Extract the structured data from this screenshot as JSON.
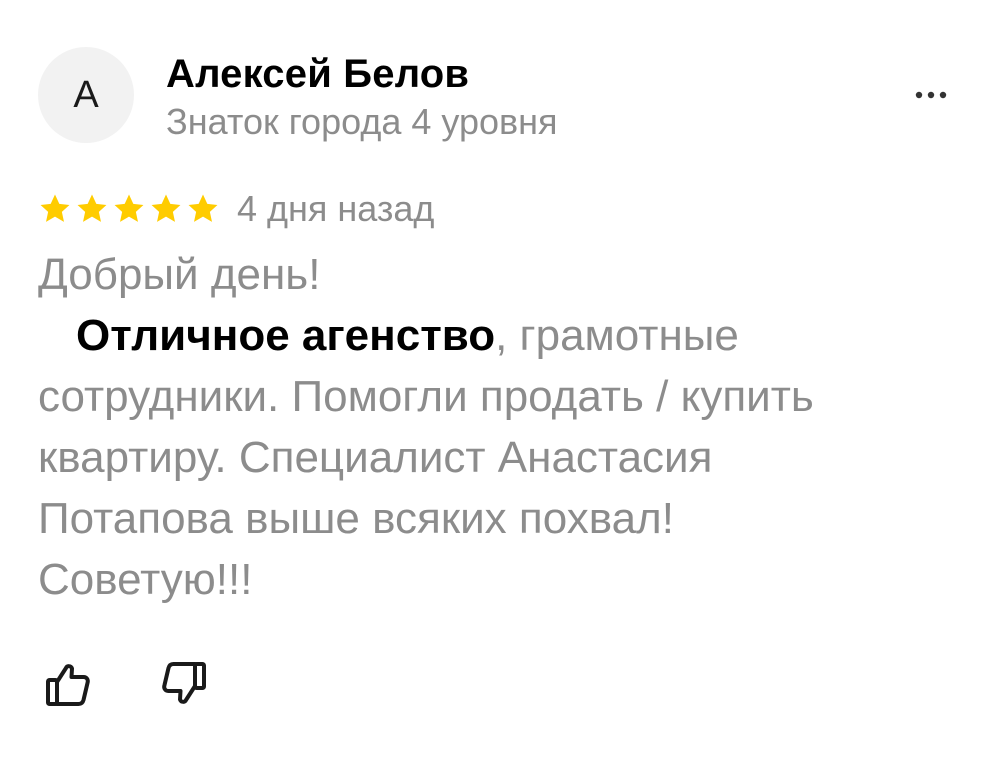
{
  "author": {
    "avatar_letter": "А",
    "name": "Алексей Белов",
    "level": "Знаток города 4 уровня"
  },
  "more_menu": {
    "icon": "more-dots-icon"
  },
  "rating": {
    "stars": 5,
    "max_stars": 5,
    "star_color": "#ffcc00",
    "date": "4 дня назад"
  },
  "review": {
    "greeting": "Добрый день!",
    "highlight": "Отличное агенство",
    "after_highlight": ", грамотные",
    "line3": "сотрудники. Помогли продать / купить",
    "line4": "квартиру. Специалист Анастасия",
    "line5": "Потапова выше всяких похвал!",
    "line6": "Советую!!!"
  },
  "reactions": {
    "like_icon": "thumbs-up-icon",
    "dislike_icon": "thumbs-down-icon"
  },
  "colors": {
    "text_primary": "#000000",
    "text_secondary": "#8c8c8c",
    "avatar_bg": "#f2f2f2",
    "star": "#ffcc00"
  }
}
